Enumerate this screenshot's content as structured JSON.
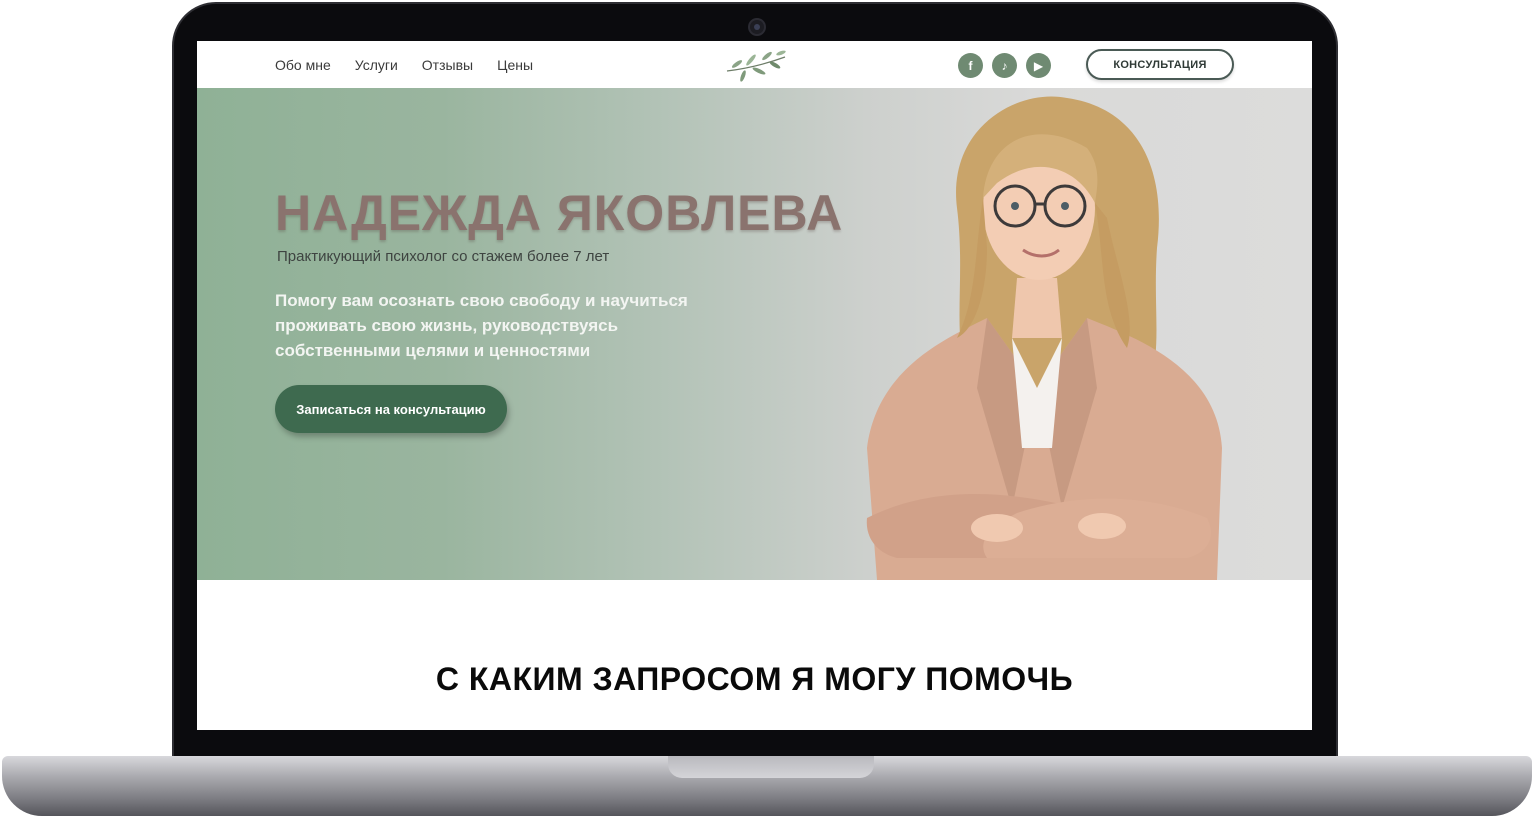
{
  "nav": {
    "items": [
      "Обо мне",
      "Услуги",
      "Отзывы",
      "Цены"
    ]
  },
  "header": {
    "logo_icon": "olive-branch-icon",
    "socials": [
      {
        "icon": "facebook-icon",
        "glyph": "f"
      },
      {
        "icon": "tiktok-icon",
        "glyph": "♪"
      },
      {
        "icon": "youtube-icon",
        "glyph": "▶"
      }
    ],
    "consult_label": "КОНСУЛЬТАЦИЯ"
  },
  "hero": {
    "title": "НАДЕЖДА ЯКОВЛЕВА",
    "subtitle": "Практикующий психолог со стажем более 7 лет",
    "description": "Помогу вам осознать свою свободу и научиться проживать свою жизнь, руководствуясь собственными целями и ценностями",
    "cta_label": "Записаться на консультацию"
  },
  "section": {
    "title": "С КАКИМ ЗАПРОСОМ Я МОГУ ПОМОЧЬ"
  },
  "colors": {
    "accent": "#3e6a4f",
    "social": "#6f8a72",
    "hero_start": "#8fb196",
    "hero_end": "#dcdcdb",
    "title": "#8a736e"
  }
}
